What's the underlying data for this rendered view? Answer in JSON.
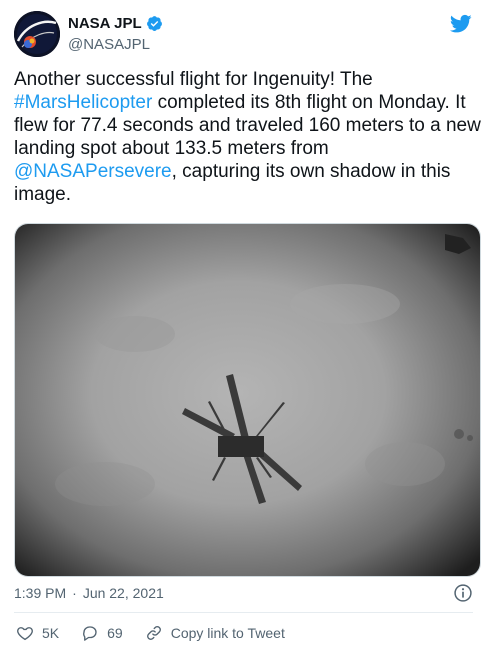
{
  "account": {
    "display_name": "NASA JPL",
    "handle": "@NASAJPL"
  },
  "tweet": {
    "segments": [
      {
        "text": "Another successful flight for Ingenuity! The ",
        "link": false
      },
      {
        "text": "#MarsHelicopter",
        "link": true
      },
      {
        "text": " completed its 8th flight on Monday. It flew for 77.4 seconds and traveled 160 meters to a new landing spot about 133.5 meters from ",
        "link": false
      },
      {
        "text": "@NASAPersevere",
        "link": true
      },
      {
        "text": ", capturing its own shadow in this image.",
        "link": false
      }
    ]
  },
  "meta": {
    "time": "1:39 PM",
    "separator": "·",
    "date": "Jun 22, 2021"
  },
  "actions": {
    "likes": "5K",
    "replies": "69",
    "copy_link": "Copy link to Tweet"
  },
  "colors": {
    "link": "#1d9bf0",
    "twitter_blue": "#1d9bf0",
    "muted": "#536471"
  },
  "icons": [
    "nasa-jpl-logo-icon",
    "verified-badge-icon",
    "twitter-bird-icon",
    "info-icon",
    "heart-icon",
    "reply-bubble-icon",
    "link-icon"
  ]
}
